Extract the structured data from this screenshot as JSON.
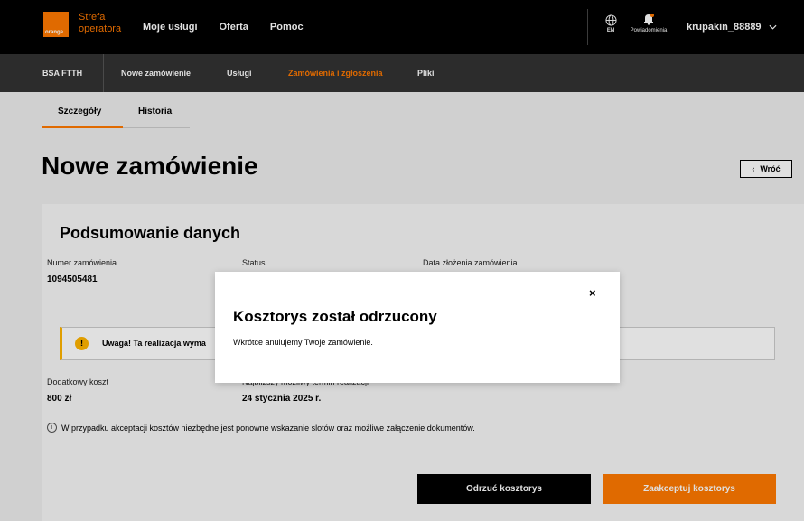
{
  "topbar": {
    "logo_text": "orange",
    "brand_line1": "Strefa",
    "brand_line2": "operatora",
    "nav": [
      "Moje usługi",
      "Oferta",
      "Pomoc"
    ],
    "lang": "EN",
    "notifications": "Powiadomienia",
    "user": "krupakin_88889"
  },
  "subnav": {
    "items": [
      "BSA FTTH",
      "Nowe zamówienie",
      "Usługi",
      "Zamówienia i zgłoszenia",
      "Pliki"
    ],
    "active": "Zamówienia i zgłoszenia"
  },
  "tabs": [
    "Szczegóły",
    "Historia"
  ],
  "page": {
    "title": "Nowe zamówienie",
    "back_label": "Wróć"
  },
  "card": {
    "title": "Podsumowanie danych",
    "order_number_label": "Numer zamówienia",
    "order_number": "1094505481",
    "status_label": "Status",
    "date_label": "Data złożenia zamówienia",
    "warning": "Uwaga! Ta realizacja wyma",
    "extra_cost_label": "Dodatkowy koszt",
    "extra_cost": "800 zł",
    "earliest_label": "Najbliższy możliwy termin realizacji",
    "earliest_date": "24 stycznia 2025 r.",
    "info": "W przypadku akceptacji kosztów niezbędne jest ponowne wskazanie slotów oraz możliwe załączenie dokumentów.",
    "reject_button": "Odrzuć kosztorys",
    "accept_button": "Zaakceptuj kosztorys"
  },
  "modal": {
    "title": "Kosztorys został odrzucony",
    "text": "Wkrótce anulujemy Twoje zamówienie.",
    "close": "×"
  },
  "colors": {
    "accent": "#ff7900",
    "warning": "#ffb400",
    "dark": "#000000",
    "subnav": "#333333"
  }
}
